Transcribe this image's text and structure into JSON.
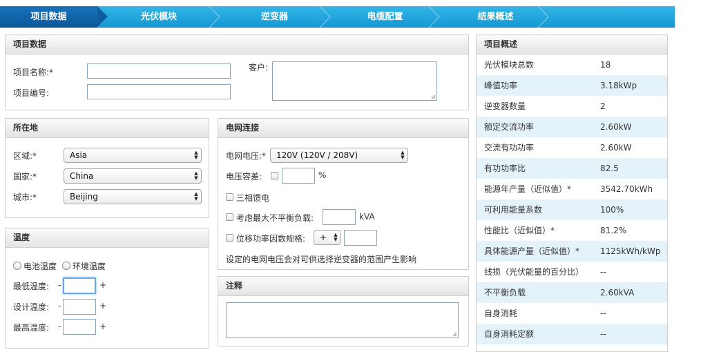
{
  "tabs": [
    {
      "label": "项目数据",
      "active": true
    },
    {
      "label": "光伏模块",
      "active": false
    },
    {
      "label": "逆变器",
      "active": false
    },
    {
      "label": "电缆配置",
      "active": false
    },
    {
      "label": "结果概述",
      "active": false
    }
  ],
  "project": {
    "title": "项目数据",
    "name_label": "项目名称:*",
    "name_value": "",
    "number_label": "项目编号:",
    "number_value": "",
    "client_label": "客户:",
    "client_value": ""
  },
  "location": {
    "title": "所在地",
    "region_label": "区域:*",
    "region_value": "Asia",
    "country_label": "国家:*",
    "country_value": "China",
    "city_label": "城市:*",
    "city_value": "Beijing"
  },
  "grid": {
    "title": "电网连接",
    "voltage_label": "电网电压:*",
    "voltage_value": "120V (120V / 208V)",
    "tolerance_label": "电压容差:",
    "tolerance_unit": "%",
    "three_phase_label": "三相馈电",
    "unbalance_label": "考虑最大不平衡负载:",
    "unbalance_unit": "kVA",
    "shift_label": "位移功率因数规格:",
    "shift_sign": "+",
    "note_text": "设定的电网电压会对可供选择逆变器的范围产生影响"
  },
  "notes": {
    "title": "注释",
    "value": ""
  },
  "temperature": {
    "title": "温度",
    "radio_cell": "电池温度",
    "radio_ambient": "环境温度",
    "min_label": "最低温度:",
    "design_label": "设计温度:",
    "max_label": "最高温度:",
    "minus": "-",
    "plus": "+"
  },
  "summary": {
    "title": "项目概述",
    "rows": [
      {
        "key": "光伏模块总数",
        "value": "18"
      },
      {
        "key": "峰值功率",
        "value": "3.18kWp"
      },
      {
        "key": "逆变器数量",
        "value": "2"
      },
      {
        "key": "额定交流功率",
        "value": "2.60kW"
      },
      {
        "key": "交流有功功率",
        "value": "2.60kW"
      },
      {
        "key": "有功功率比",
        "value": "82.5"
      },
      {
        "key": "能源年产量（近似值）*",
        "value": "3542.70kWh"
      },
      {
        "key": "可利用能量系数",
        "value": "100%"
      },
      {
        "key": "性能比（近似值）*",
        "value": "81.2%"
      },
      {
        "key": "具体能源产量（近似值）*",
        "value": "1125kWh/kWp"
      },
      {
        "key": "线损（光伏能量的百分比）",
        "value": "--"
      },
      {
        "key": "不平衡负载",
        "value": "2.60kVA"
      },
      {
        "key": "自身消耗",
        "value": "--"
      },
      {
        "key": "自身消耗定额",
        "value": "--"
      }
    ]
  },
  "colors": {
    "tab_bar": "#1596d2",
    "tab_active": "#0d5699",
    "row_alt": "#e4f2fa",
    "input_border": "#8aa6bf"
  }
}
